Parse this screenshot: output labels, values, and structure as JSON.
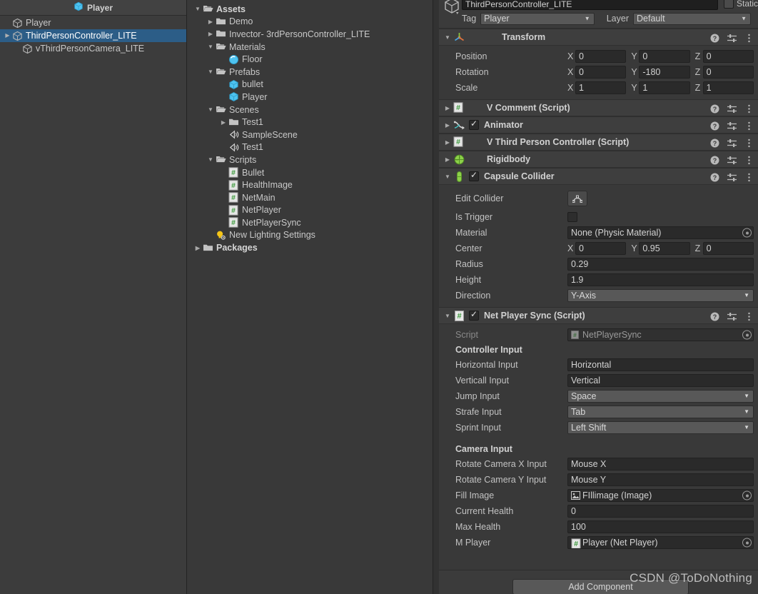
{
  "hierarchy": {
    "title": "Player",
    "items": [
      {
        "label": "Player",
        "indent": 0,
        "arrow": "none",
        "selected": false,
        "icon": "gameobject-cube-icon"
      },
      {
        "label": "ThirdPersonController_LITE",
        "indent": 0,
        "arrow": "collapsed",
        "selected": true,
        "icon": "gameobject-cube-icon"
      },
      {
        "label": "vThirdPersonCamera_LITE",
        "indent": 1,
        "arrow": "none",
        "selected": false,
        "icon": "gameobject-cube-icon"
      }
    ]
  },
  "project": {
    "items": [
      {
        "label": "Assets",
        "indent": 0,
        "arrow": "expanded",
        "icon": "folder-open-icon",
        "bold": true
      },
      {
        "label": "Demo",
        "indent": 1,
        "arrow": "collapsed",
        "icon": "folder-icon",
        "bold": false
      },
      {
        "label": "Invector- 3rdPersonController_LITE",
        "indent": 1,
        "arrow": "collapsed",
        "icon": "folder-icon",
        "bold": false
      },
      {
        "label": "Materials",
        "indent": 1,
        "arrow": "expanded",
        "icon": "folder-open-icon",
        "bold": false
      },
      {
        "label": "Floor",
        "indent": 2,
        "arrow": "none",
        "icon": "material-sphere-icon",
        "bold": false
      },
      {
        "label": "Prefabs",
        "indent": 1,
        "arrow": "expanded",
        "icon": "folder-open-icon",
        "bold": false
      },
      {
        "label": "bullet",
        "indent": 2,
        "arrow": "none",
        "icon": "prefab-cube-icon",
        "bold": false
      },
      {
        "label": "Player",
        "indent": 2,
        "arrow": "none",
        "icon": "prefab-cube-icon",
        "bold": false
      },
      {
        "label": "Scenes",
        "indent": 1,
        "arrow": "expanded",
        "icon": "folder-open-icon",
        "bold": false
      },
      {
        "label": "Test1",
        "indent": 2,
        "arrow": "collapsed",
        "icon": "folder-icon",
        "bold": false
      },
      {
        "label": "SampleScene",
        "indent": 2,
        "arrow": "none",
        "icon": "scene-icon",
        "bold": false
      },
      {
        "label": "Test1",
        "indent": 2,
        "arrow": "none",
        "icon": "scene-icon",
        "bold": false
      },
      {
        "label": "Scripts",
        "indent": 1,
        "arrow": "expanded",
        "icon": "folder-open-icon",
        "bold": false
      },
      {
        "label": "Bullet",
        "indent": 2,
        "arrow": "none",
        "icon": "csharp-script-icon",
        "bold": false
      },
      {
        "label": "HealthImage",
        "indent": 2,
        "arrow": "none",
        "icon": "csharp-script-icon",
        "bold": false
      },
      {
        "label": "NetMain",
        "indent": 2,
        "arrow": "none",
        "icon": "csharp-script-icon",
        "bold": false
      },
      {
        "label": "NetPlayer",
        "indent": 2,
        "arrow": "none",
        "icon": "csharp-script-icon",
        "bold": false
      },
      {
        "label": "NetPlayerSync",
        "indent": 2,
        "arrow": "none",
        "icon": "csharp-script-icon",
        "bold": false
      },
      {
        "label": "New Lighting Settings",
        "indent": 1,
        "arrow": "none",
        "icon": "lighting-settings-icon",
        "bold": false
      },
      {
        "label": "Packages",
        "indent": 0,
        "arrow": "collapsed",
        "icon": "folder-icon",
        "bold": true
      }
    ]
  },
  "inspector": {
    "object_name": "ThirdPersonController_LITE",
    "static_label": "Static",
    "tag_label": "Tag",
    "tag_value": "Player",
    "layer_label": "Layer",
    "layer_value": "Default",
    "transform": {
      "title": "Transform",
      "rows": [
        {
          "label": "Position",
          "x": "0",
          "y": "0",
          "z": "0"
        },
        {
          "label": "Rotation",
          "x": "0",
          "y": "-180",
          "z": "0"
        },
        {
          "label": "Scale",
          "x": "1",
          "y": "1",
          "z": "1"
        }
      ]
    },
    "collapsed_components": [
      {
        "title": "V Comment (Script)",
        "icon": "csharp-script-icon",
        "checkbox": false
      },
      {
        "title": "Animator",
        "icon": "animator-icon",
        "checkbox": true
      },
      {
        "title": "V Third Person Controller (Script)",
        "icon": "csharp-script-icon",
        "checkbox": false
      },
      {
        "title": "Rigidbody",
        "icon": "rigidbody-icon",
        "checkbox": false
      }
    ],
    "capsule_collider": {
      "title": "Capsule Collider",
      "icon": "capsule-collider-icon",
      "edit_collider_label": "Edit Collider",
      "is_trigger_label": "Is Trigger",
      "material_label": "Material",
      "material_value": "None (Physic Material)",
      "center_label": "Center",
      "center": {
        "x": "0",
        "y": "0.95",
        "z": "0"
      },
      "radius_label": "Radius",
      "radius_value": "0.29",
      "height_label": "Height",
      "height_value": "1.9",
      "direction_label": "Direction",
      "direction_value": "Y-Axis"
    },
    "net_player_sync": {
      "title": "Net Player Sync (Script)",
      "icon": "csharp-script-icon",
      "script_label": "Script",
      "script_value": "NetPlayerSync",
      "controller_input_header": "Controller Input",
      "controller_rows": [
        {
          "label": "Horizontal Input",
          "value": "Horizontal",
          "type": "text"
        },
        {
          "label": "Verticall Input",
          "value": "Vertical",
          "type": "text"
        },
        {
          "label": "Jump Input",
          "value": "Space",
          "type": "dropdown"
        },
        {
          "label": "Strafe Input",
          "value": "Tab",
          "type": "dropdown"
        },
        {
          "label": "Sprint Input",
          "value": "Left Shift",
          "type": "dropdown"
        }
      ],
      "camera_input_header": "Camera Input",
      "camera_rows": [
        {
          "label": "Rotate Camera X Input",
          "value": "Mouse X",
          "type": "text"
        },
        {
          "label": "Rotate Camera Y Input",
          "value": "Mouse Y",
          "type": "text"
        },
        {
          "label": "Fill Image",
          "value": "FIllimage (Image)",
          "type": "object",
          "icon": "image-component-icon"
        },
        {
          "label": "Current Health",
          "value": "0",
          "type": "text"
        },
        {
          "label": "Max Health",
          "value": "100",
          "type": "text"
        },
        {
          "label": "M Player",
          "value": "Player (Net Player)",
          "type": "object",
          "icon": "csharp-script-icon"
        }
      ]
    },
    "add_component_label": "Add Component"
  },
  "watermark": "CSDN @ToDoNothing",
  "colors": {
    "selection_blue": "#2c5d87",
    "panel_bg": "#393939",
    "header_bg": "#3e3e3e",
    "field_bg": "#2a2a2a",
    "dropdown_bg": "#585858",
    "script_green": "#4caf50",
    "cube_blue": "#4ec3f0"
  }
}
